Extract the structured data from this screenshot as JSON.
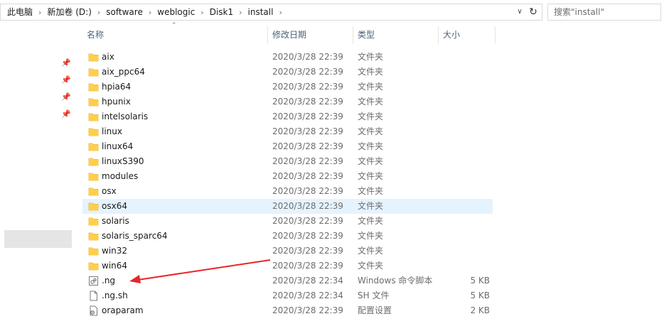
{
  "breadcrumb": {
    "items": [
      "此电脑",
      "新加卷 (D:)",
      "software",
      "weblogic",
      "Disk1",
      "install"
    ],
    "separator": "›"
  },
  "search": {
    "placeholder": "搜索\"install\""
  },
  "columns": {
    "name": "名称",
    "date": "修改日期",
    "type": "类型",
    "size": "大小"
  },
  "files": [
    {
      "name": "aix",
      "date": "2020/3/28 22:39",
      "type": "文件夹",
      "size": "",
      "icon": "folder-icon"
    },
    {
      "name": "aix_ppc64",
      "date": "2020/3/28 22:39",
      "type": "文件夹",
      "size": "",
      "icon": "folder-icon"
    },
    {
      "name": "hpia64",
      "date": "2020/3/28 22:39",
      "type": "文件夹",
      "size": "",
      "icon": "folder-icon"
    },
    {
      "name": "hpunix",
      "date": "2020/3/28 22:39",
      "type": "文件夹",
      "size": "",
      "icon": "folder-icon"
    },
    {
      "name": "intelsolaris",
      "date": "2020/3/28 22:39",
      "type": "文件夹",
      "size": "",
      "icon": "folder-icon"
    },
    {
      "name": "linux",
      "date": "2020/3/28 22:39",
      "type": "文件夹",
      "size": "",
      "icon": "folder-icon"
    },
    {
      "name": "linux64",
      "date": "2020/3/28 22:39",
      "type": "文件夹",
      "size": "",
      "icon": "folder-icon"
    },
    {
      "name": "linuxS390",
      "date": "2020/3/28 22:39",
      "type": "文件夹",
      "size": "",
      "icon": "folder-icon"
    },
    {
      "name": "modules",
      "date": "2020/3/28 22:39",
      "type": "文件夹",
      "size": "",
      "icon": "folder-icon"
    },
    {
      "name": "osx",
      "date": "2020/3/28 22:39",
      "type": "文件夹",
      "size": "",
      "icon": "folder-icon"
    },
    {
      "name": "osx64",
      "date": "2020/3/28 22:39",
      "type": "文件夹",
      "size": "",
      "icon": "folder-icon",
      "selected": true
    },
    {
      "name": "solaris",
      "date": "2020/3/28 22:39",
      "type": "文件夹",
      "size": "",
      "icon": "folder-icon"
    },
    {
      "name": "solaris_sparc64",
      "date": "2020/3/28 22:39",
      "type": "文件夹",
      "size": "",
      "icon": "folder-icon"
    },
    {
      "name": "win32",
      "date": "2020/3/28 22:39",
      "type": "文件夹",
      "size": "",
      "icon": "folder-icon"
    },
    {
      "name": "win64",
      "date": "2020/3/28 22:39",
      "type": "文件夹",
      "size": "",
      "icon": "folder-icon"
    },
    {
      "name": ".ng",
      "date": "2020/3/28 22:34",
      "type": "Windows 命令脚本",
      "size": "5 KB",
      "icon": "script-icon"
    },
    {
      "name": ".ng.sh",
      "date": "2020/3/28 22:34",
      "type": "SH 文件",
      "size": "5 KB",
      "icon": "file-icon"
    },
    {
      "name": "oraparam",
      "date": "2020/3/28 22:39",
      "type": "配置设置",
      "size": "2 KB",
      "icon": "settings-file-icon"
    }
  ],
  "colors": {
    "folder": "#ffd766",
    "selection": "#e5f3ff",
    "header_text": "#4c607a",
    "arrow": "#e8262a"
  }
}
